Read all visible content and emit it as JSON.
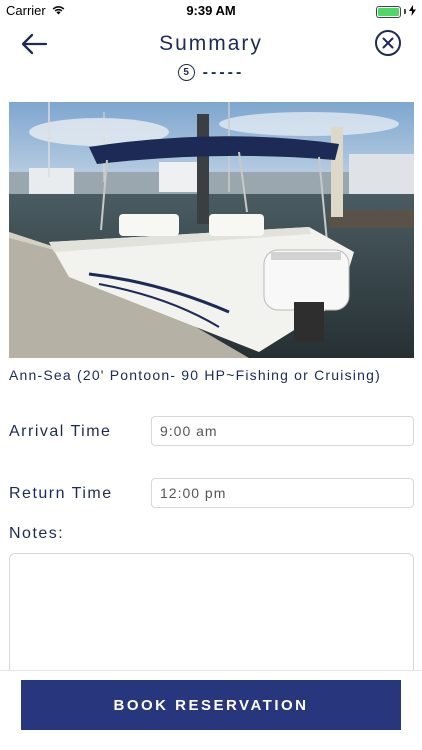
{
  "status_bar": {
    "carrier": "Carrier",
    "time": "9:39 AM",
    "battery_level": 1.0,
    "battery_color": "#4cd964"
  },
  "nav": {
    "back_icon": "arrow-left-icon",
    "title": "Summary",
    "close_icon": "close-circle-icon",
    "step_number": "5",
    "step_dashes": "-----"
  },
  "listing": {
    "photo": "boat-photo",
    "name": "Ann-Sea (20' Pontoon- 90 HP~Fishing or Cruising)"
  },
  "form": {
    "arrival_label": "Arrival Time",
    "arrival_value": "9:00 am",
    "return_label": "Return Time",
    "return_value": "12:00 pm",
    "notes_label": "Notes:",
    "notes_value": ""
  },
  "actions": {
    "book_label": "BOOK RESERVATION"
  },
  "colors": {
    "primary": "#28367e",
    "text": "#1f2a55",
    "border": "#d8d8d8"
  }
}
